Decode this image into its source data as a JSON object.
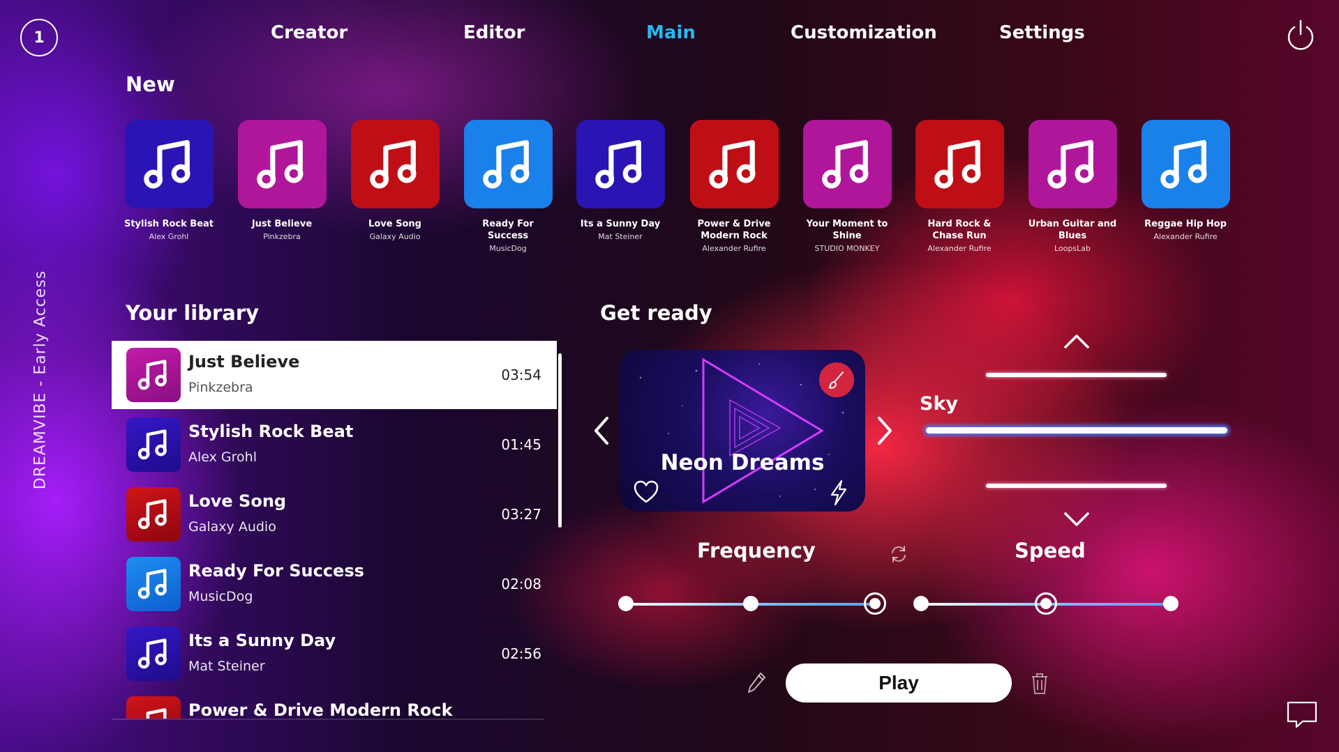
{
  "badge": "1",
  "nav": [
    {
      "label": "Creator"
    },
    {
      "label": "Editor"
    },
    {
      "label": "Main"
    },
    {
      "label": "Customization"
    },
    {
      "label": "Settings"
    }
  ],
  "side_label": "DREAMVIBE - Early Access",
  "new_section": {
    "title": "New",
    "items": [
      {
        "name": "Stylish Rock Beat",
        "artist": "Alex Grohl",
        "color": "#2a14b4"
      },
      {
        "name": "Just Believe",
        "artist": "Pinkzebra",
        "color": "#b0169a"
      },
      {
        "name": "Love Song",
        "artist": "Galaxy Audio",
        "color": "#c00e16"
      },
      {
        "name": "Ready For Success",
        "artist": "MusicDog",
        "color": "#1a80ea"
      },
      {
        "name": "Its a Sunny Day",
        "artist": "Mat Steiner",
        "color": "#2a14b4"
      },
      {
        "name": "Power & Drive Modern Rock",
        "artist": "Alexander Rufire",
        "color": "#c00e16"
      },
      {
        "name": "Your Moment to Shine",
        "artist": "STUDIO MONKEY",
        "color": "#b0169a"
      },
      {
        "name": "Hard Rock & Chase Run",
        "artist": "Alexander Rufire",
        "color": "#c00e16"
      },
      {
        "name": "Urban Guitar and Blues",
        "artist": "LoopsLab",
        "color": "#b0169a"
      },
      {
        "name": "Reggae Hip Hop",
        "artist": "Alexander Rufire",
        "color": "#1a80ea"
      }
    ]
  },
  "library": {
    "title": "Your library",
    "items": [
      {
        "name": "Just Believe",
        "artist": "Pinkzebra",
        "duration": "03:54"
      },
      {
        "name": "Stylish Rock Beat",
        "artist": "Alex Grohl",
        "duration": "01:45"
      },
      {
        "name": "Love Song",
        "artist": "Galaxy Audio",
        "duration": "03:27"
      },
      {
        "name": "Ready For Success",
        "artist": "MusicDog",
        "duration": "02:08"
      },
      {
        "name": "Its a Sunny Day",
        "artist": "Mat Steiner",
        "duration": "02:56"
      },
      {
        "name": "Power & Drive Modern Rock",
        "artist": "",
        "duration": ""
      }
    ]
  },
  "get_ready": {
    "title": "Get ready",
    "card_name": "Neon Dreams"
  },
  "environment": {
    "selected": "Sky"
  },
  "frequency": {
    "label": "Frequency",
    "steps": 3,
    "selected_index": 2
  },
  "speed": {
    "label": "Speed",
    "steps": 3,
    "selected_index": 1
  },
  "play_label": "Play",
  "colors": {
    "accent": "#29b8f0",
    "slider": "#7ab8ff"
  }
}
